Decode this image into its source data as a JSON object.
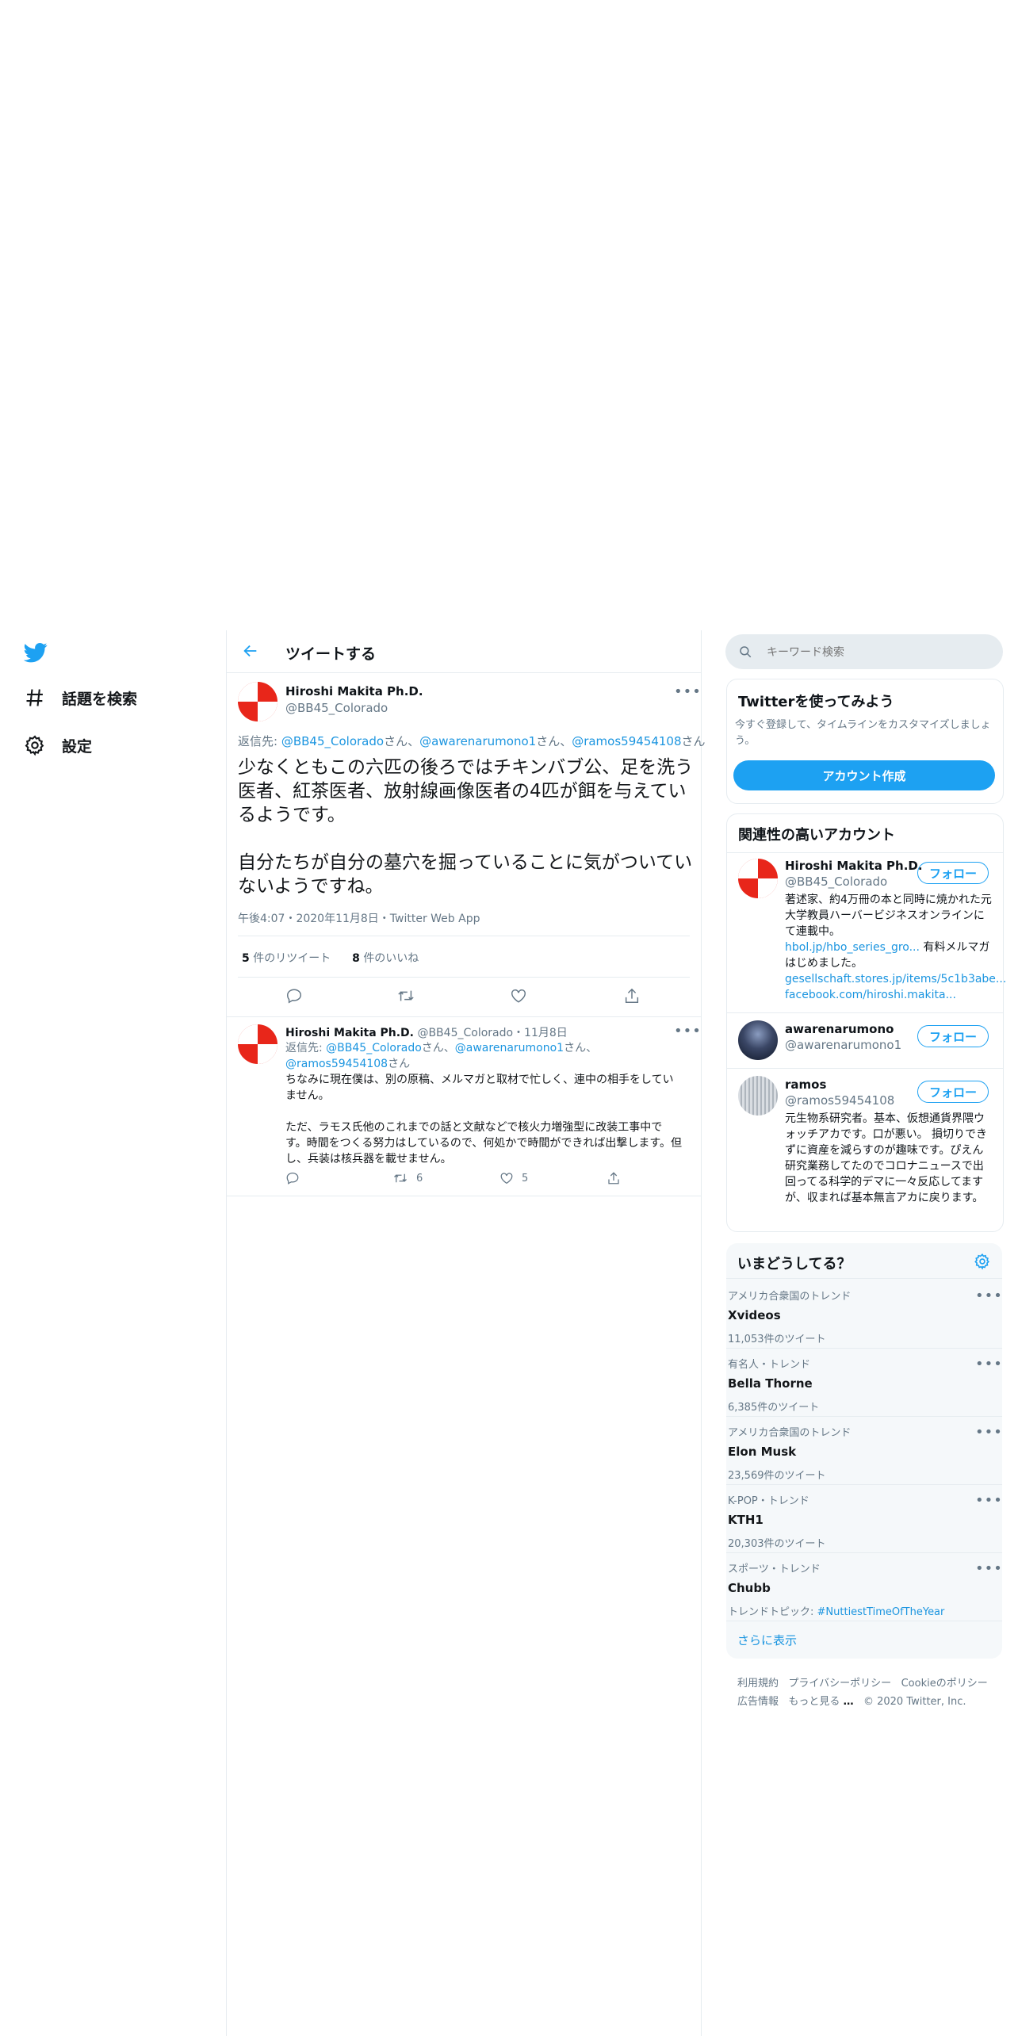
{
  "nav": {
    "explore": "話題を検索",
    "settings": "設定"
  },
  "header": {
    "title": "ツイートする"
  },
  "main_tweet": {
    "name": "Hiroshi Makita Ph.D.",
    "handle": "@BB45_Colorado",
    "reply_prefix": "返信先: ",
    "reply_to_1": "@BB45_Colorado",
    "reply_sep_1": "さん、",
    "reply_to_2": "@awarenarumono1",
    "reply_sep_2": "さん、",
    "reply_to_3": "@ramos59454108",
    "reply_suffix": "さん",
    "text_p1": "少なくともこの六匹の後ろではチキンバブ公、足を洗う医者、紅茶医者、放射線画像医者の4匹が餌を与えているようです。",
    "text_p2": "自分たちが自分の墓穴を掘っていることに気がついていないようですね。",
    "timestamp": "午後4:07・2020年11月8日・Twitter Web App",
    "retweets": "5",
    "retweets_label": "件のリツイート",
    "likes": "8",
    "likes_label": "件のいいね"
  },
  "reply_tweet": {
    "name": "Hiroshi Makita Ph.D.",
    "handle": "@BB45_Colorado・11月8日",
    "reply_prefix": "返信先: ",
    "reply_to_1": "@BB45_Colorado",
    "reply_sep_1": "さん、",
    "reply_to_2": "@awarenarumono1",
    "reply_sep_2": "さん、",
    "reply_to_3": "@ramos59454108",
    "reply_suffix": "さん",
    "text_p1": "ちなみに現在僕は、別の原稿、メルマガと取材で忙しく、連中の相手をしていません。",
    "text_p2": "ただ、ラモス氏他のこれまでの話と文献などで核火力増強型に改装工事中です。時間をつくる努力はしているので、何処かで時間ができれば出撃します。但し、兵装は核兵器を載せません。",
    "retweet_count": "6",
    "like_count": "5"
  },
  "search": {
    "placeholder": "キーワード検索"
  },
  "signup": {
    "title": "Twitterを使ってみよう",
    "desc": "今すぐ登録して、タイムラインをカスタマイズしましょう。",
    "button": "アカウント作成"
  },
  "related": {
    "title": "関連性の高いアカウント",
    "follow_label": "フォロー",
    "accounts": [
      {
        "name": "Hiroshi Makita Ph.D.",
        "handle": "@BB45_Colorado",
        "bio": "著述家、約4万冊の本と同時に焼かれた元大学教員ハーバービジネスオンラインにて連載中。",
        "link1": "hbol.jp/hbo_series_gro...",
        "bio2": " 有料メルマガはじめました。",
        "link2": "gesellschaft.stores.jp/items/5c1b3abe...",
        "link3": "facebook.com/hiroshi.makita..."
      },
      {
        "name": "awarenarumono",
        "handle": "@awarenarumono1"
      },
      {
        "name": "ramos",
        "handle": "@ramos59454108",
        "bio": "元生物系研究者。基本、仮想通貨界隈ウォッチアカです。口が悪い。 損切りできずに資産を減らすのが趣味です。ぴえん 研究業務してたのでコロナニュースで出回ってる科学的デマに一々反応してますが、収まれば基本無言アカに戻ります。"
      }
    ]
  },
  "trends": {
    "title": "いまどうしてる？",
    "items": [
      {
        "category": "アメリカ合衆国のトレンド",
        "name": "Xvideos",
        "count": "11,053件のツイート"
      },
      {
        "category": "有名人・トレンド",
        "name": "Bella Thorne",
        "count": "6,385件のツイート"
      },
      {
        "category": "アメリカ合衆国のトレンド",
        "name": "Elon Musk",
        "count": "23,569件のツイート"
      },
      {
        "category": "K-POP・トレンド",
        "name": "KTH1",
        "count": "20,303件のツイート"
      },
      {
        "category": "スポーツ・トレンド",
        "name": "Chubb",
        "count": "トレンドトピック: ",
        "topic": "#NuttiestTimeOfTheYear"
      }
    ],
    "show_more": "さらに表示"
  },
  "footer": {
    "terms": "利用規約",
    "privacy": "プライバシーポリシー",
    "cookie": "Cookieのポリシー",
    "ads": "広告情報",
    "more": "もっと見る",
    "copyright": "© 2020 Twitter, Inc."
  }
}
